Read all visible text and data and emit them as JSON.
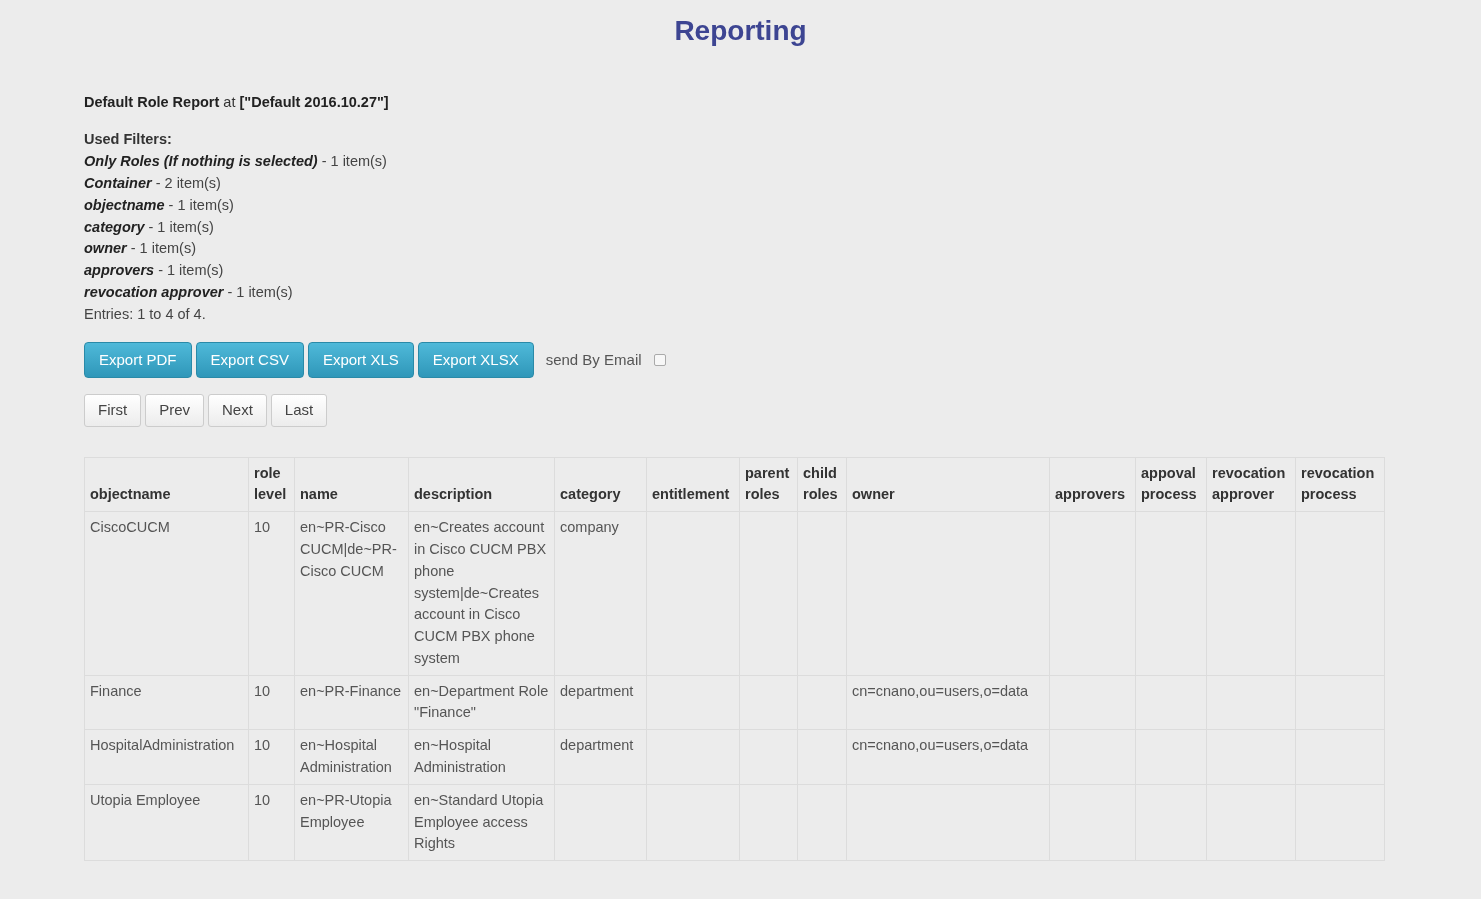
{
  "title": "Reporting",
  "report_heading": "**Default Role Report** at **[\"Default 2016.10.27\"]**",
  "filters_label": "Used Filters:",
  "filters": [
    {
      "name": "Only Roles (If nothing is selected)",
      "count": " - 1 item(s)"
    },
    {
      "name": "Container",
      "count": " - 2 item(s)"
    },
    {
      "name": "objectname",
      "count": " - 1 item(s)"
    },
    {
      "name": "category",
      "count": " - 1 item(s)"
    },
    {
      "name": "owner",
      "count": " - 1 item(s)"
    },
    {
      "name": "approvers",
      "count": " - 1 item(s)"
    },
    {
      "name": "revocation approver",
      "count": " - 1 item(s)"
    }
  ],
  "entries": "Entries: 1 to 4 of 4.",
  "export_buttons": [
    "Export PDF",
    "Export CSV",
    "Export XLS",
    "Export XLSX"
  ],
  "send_by_email": {
    "label": "send By Email",
    "checked": false
  },
  "pager": [
    "First",
    "Prev",
    "Next",
    "Last"
  ],
  "table": {
    "columns": [
      "objectname",
      "role level",
      "name",
      "description",
      "category",
      "entitlement",
      "parent roles",
      "child roles",
      "owner",
      "approvers",
      "appoval process",
      "revocation approver",
      "revocation process"
    ],
    "rows": [
      [
        "CiscoCUCM",
        "10",
        "en~PR-Cisco CUCM|de~PR-Cisco CUCM",
        "en~Creates account in Cisco CUCM PBX phone system|de~Creates account in Cisco CUCM PBX phone system",
        "company",
        "",
        "",
        "",
        "",
        "",
        "",
        "",
        ""
      ],
      [
        "Finance",
        "10",
        "en~PR-Finance",
        "en~Department Role \"Finance\"",
        "department",
        "",
        "",
        "",
        "cn=cnano,ou=users,o=data",
        "",
        "",
        "",
        ""
      ],
      [
        "HospitalAdministration",
        "10",
        "en~Hospital Administration",
        "en~Hospital Administration",
        "department",
        "",
        "",
        "",
        "cn=cnano,ou=users,o=data",
        "",
        "",
        "",
        ""
      ],
      [
        "Utopia Employee",
        "10",
        "en~PR-Utopia Employee",
        "en~Standard Utopia Employee access Rights",
        "",
        "",
        "",
        "",
        "",
        "",
        "",
        "",
        ""
      ]
    ]
  }
}
